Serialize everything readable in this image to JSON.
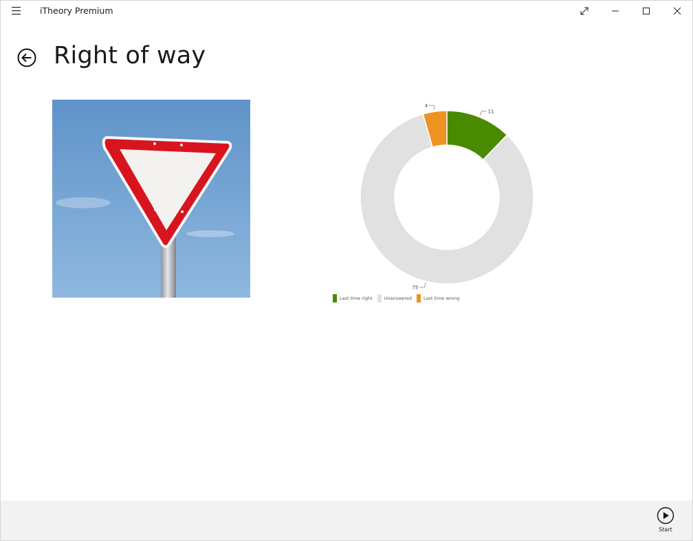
{
  "window": {
    "app_title": "iTheory Premium"
  },
  "header": {
    "page_title": "Right of way"
  },
  "icons": {
    "menu": "hamburger-icon",
    "expand": "expand-icon",
    "minimize": "minimize-icon",
    "maximize": "maximize-icon",
    "close": "close-icon",
    "back": "back-arrow-icon",
    "start": "play-icon"
  },
  "colors": {
    "right": "#498a00",
    "unanswered": "#e1e1e1",
    "wrong": "#ee931f",
    "appbar": "#f2f2f2"
  },
  "chart_data": {
    "type": "pie",
    "donut": true,
    "categories": [
      "Last time right",
      "Unanswered",
      "Last time wrong"
    ],
    "values": [
      11,
      75,
      4
    ],
    "colors": [
      "#498a00",
      "#e1e1e1",
      "#ee931f"
    ],
    "legend": "bottom-left"
  },
  "appbar": {
    "start_label": "Start"
  }
}
